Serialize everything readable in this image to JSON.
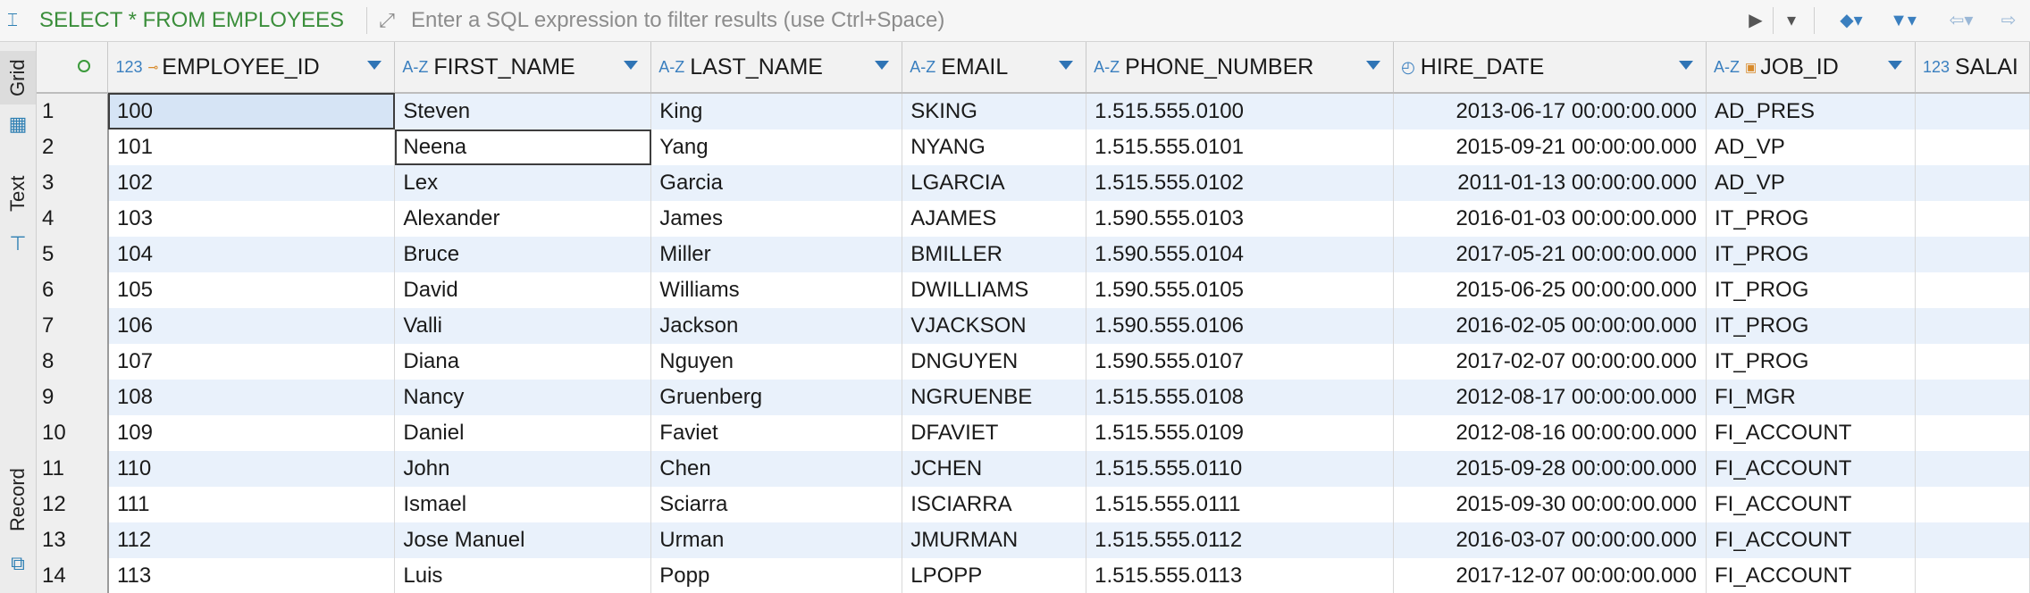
{
  "toolbar": {
    "query": "SELECT * FROM EMPLOYEES",
    "filter_placeholder": "Enter a SQL expression to filter results (use Ctrl+Space)",
    "icons": [
      "sql-editor-icon",
      "expand-icon",
      "run-filter-icon",
      "filter-history-icon",
      "eraser-icon",
      "funnel-icon",
      "back-icon",
      "forward-icon"
    ]
  },
  "side_tabs": {
    "grid": "Grid",
    "text": "Text",
    "record": "Record"
  },
  "columns": [
    {
      "type": "123",
      "key": true,
      "name": "EMPLOYEE_ID"
    },
    {
      "type": "A-Z",
      "name": "FIRST_NAME"
    },
    {
      "type": "A-Z",
      "name": "LAST_NAME"
    },
    {
      "type": "A-Z",
      "name": "EMAIL"
    },
    {
      "type": "A-Z",
      "name": "PHONE_NUMBER"
    },
    {
      "type": "clock",
      "name": "HIRE_DATE"
    },
    {
      "type": "A-Z",
      "key": true,
      "name": "JOB_ID"
    },
    {
      "type": "123",
      "name": "SALAI"
    }
  ],
  "rows": [
    {
      "n": "1",
      "id": "100",
      "first": "Steven",
      "last": "King",
      "email": "SKING",
      "phone": "1.515.555.0100",
      "hire": "2013-06-17 00:00:00.000",
      "job": "AD_PRES"
    },
    {
      "n": "2",
      "id": "101",
      "first": "Neena",
      "last": "Yang",
      "email": "NYANG",
      "phone": "1.515.555.0101",
      "hire": "2015-09-21 00:00:00.000",
      "job": "AD_VP"
    },
    {
      "n": "3",
      "id": "102",
      "first": "Lex",
      "last": "Garcia",
      "email": "LGARCIA",
      "phone": "1.515.555.0102",
      "hire": "2011-01-13 00:00:00.000",
      "job": "AD_VP"
    },
    {
      "n": "4",
      "id": "103",
      "first": "Alexander",
      "last": "James",
      "email": "AJAMES",
      "phone": "1.590.555.0103",
      "hire": "2016-01-03 00:00:00.000",
      "job": "IT_PROG"
    },
    {
      "n": "5",
      "id": "104",
      "first": "Bruce",
      "last": "Miller",
      "email": "BMILLER",
      "phone": "1.590.555.0104",
      "hire": "2017-05-21 00:00:00.000",
      "job": "IT_PROG"
    },
    {
      "n": "6",
      "id": "105",
      "first": "David",
      "last": "Williams",
      "email": "DWILLIAMS",
      "phone": "1.590.555.0105",
      "hire": "2015-06-25 00:00:00.000",
      "job": "IT_PROG"
    },
    {
      "n": "7",
      "id": "106",
      "first": "Valli",
      "last": "Jackson",
      "email": "VJACKSON",
      "phone": "1.590.555.0106",
      "hire": "2016-02-05 00:00:00.000",
      "job": "IT_PROG"
    },
    {
      "n": "8",
      "id": "107",
      "first": "Diana",
      "last": "Nguyen",
      "email": "DNGUYEN",
      "phone": "1.590.555.0107",
      "hire": "2017-02-07 00:00:00.000",
      "job": "IT_PROG"
    },
    {
      "n": "9",
      "id": "108",
      "first": "Nancy",
      "last": "Gruenberg",
      "email": "NGRUENBE",
      "phone": "1.515.555.0108",
      "hire": "2012-08-17 00:00:00.000",
      "job": "FI_MGR"
    },
    {
      "n": "10",
      "id": "109",
      "first": "Daniel",
      "last": "Faviet",
      "email": "DFAVIET",
      "phone": "1.515.555.0109",
      "hire": "2012-08-16 00:00:00.000",
      "job": "FI_ACCOUNT"
    },
    {
      "n": "11",
      "id": "110",
      "first": "John",
      "last": "Chen",
      "email": "JCHEN",
      "phone": "1.515.555.0110",
      "hire": "2015-09-28 00:00:00.000",
      "job": "FI_ACCOUNT"
    },
    {
      "n": "12",
      "id": "111",
      "first": "Ismael",
      "last": "Sciarra",
      "email": "ISCIARRA",
      "phone": "1.515.555.0111",
      "hire": "2015-09-30 00:00:00.000",
      "job": "FI_ACCOUNT"
    },
    {
      "n": "13",
      "id": "112",
      "first": "Jose Manuel",
      "last": "Urman",
      "email": "JMURMAN",
      "phone": "1.515.555.0112",
      "hire": "2016-03-07 00:00:00.000",
      "job": "FI_ACCOUNT"
    },
    {
      "n": "14",
      "id": "113",
      "first": "Luis",
      "last": "Popp",
      "email": "LPOPP",
      "phone": "1.515.555.0113",
      "hire": "2017-12-07 00:00:00.000",
      "job": "FI_ACCOUNT"
    }
  ]
}
